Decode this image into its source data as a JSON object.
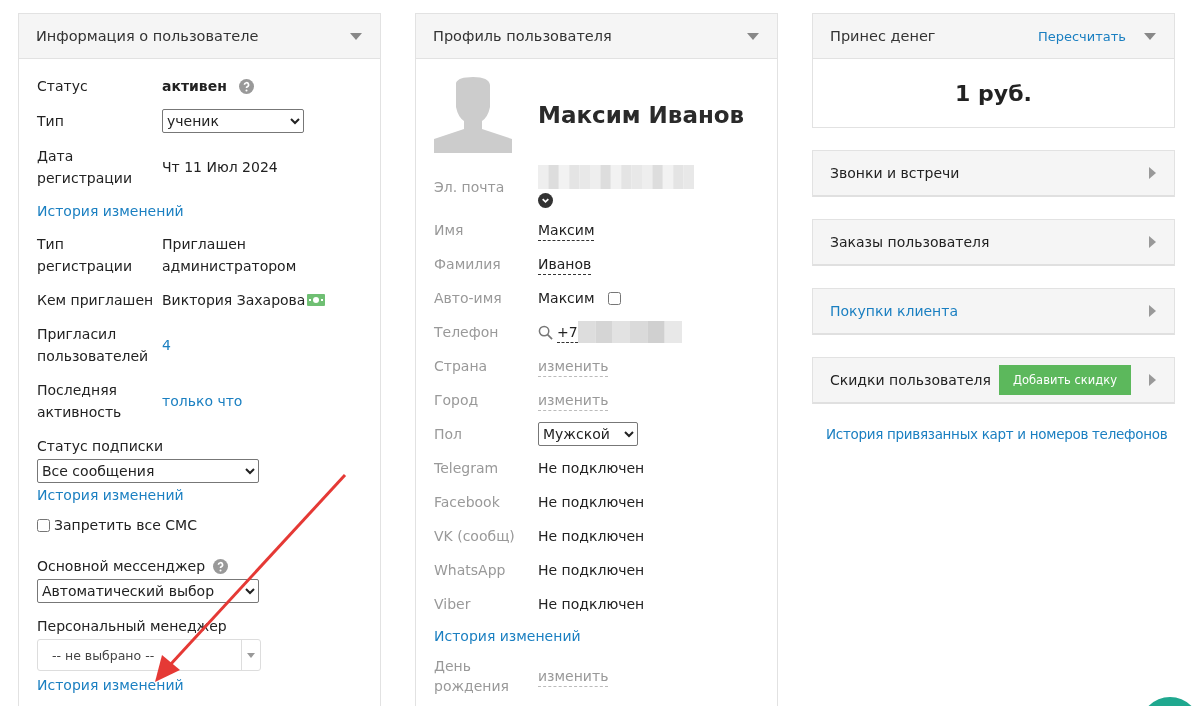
{
  "user_info": {
    "title": "Информация о пользователе",
    "rows": [
      {
        "kind": "bold_field",
        "label": "Статус",
        "value": "активен",
        "help": true
      },
      {
        "kind": "select",
        "label": "Тип",
        "value": "ученик"
      },
      {
        "kind": "field",
        "label": "Дата регистрации",
        "value": "Чт 11 Июл 2024"
      },
      {
        "kind": "link",
        "text": "История изменений"
      },
      {
        "kind": "field",
        "label": "Тип регистрации",
        "value": "Приглашен администратором"
      },
      {
        "kind": "field",
        "label": "Кем приглашен",
        "value": "Виктория Захарова",
        "money_icon": true
      },
      {
        "kind": "link_field",
        "label": "Пригласил пользователей",
        "value": "4"
      },
      {
        "kind": "link_field",
        "label": "Последняя активность",
        "value": "только что"
      },
      {
        "kind": "stacked_select",
        "label": "Статус подписки",
        "value": "Все сообщения"
      },
      {
        "kind": "link",
        "text": "История изменений"
      },
      {
        "kind": "checkbox",
        "label": "Запретить все СМС",
        "checked": false
      },
      {
        "kind": "stacked_select",
        "label": "Основной мессенджер",
        "value": "Автоматический выбор",
        "help": true
      },
      {
        "kind": "combo",
        "label": "Персональный менеджер",
        "value": "-- не выбрано --"
      },
      {
        "kind": "link",
        "text": "История изменений"
      }
    ]
  },
  "profile": {
    "title": "Профиль пользователя",
    "name": "Максим Иванов",
    "rows": [
      {
        "kind": "redacted",
        "label": "Эл. почта"
      },
      {
        "kind": "dashed",
        "label": "Имя",
        "value": "Максим",
        "muted": false
      },
      {
        "kind": "dashed",
        "label": "Фамилия",
        "value": "Иванов",
        "muted": false
      },
      {
        "kind": "checkbox",
        "label": "Авто-имя",
        "value": "Максим",
        "checked": false
      },
      {
        "kind": "phone",
        "label": "Телефон",
        "value": "+7"
      },
      {
        "kind": "dashed",
        "label": "Страна",
        "value": "изменить",
        "muted": true
      },
      {
        "kind": "dashed",
        "label": "Город",
        "value": "изменить",
        "muted": true
      },
      {
        "kind": "select",
        "label": "Пол",
        "value": "Мужской"
      },
      {
        "kind": "text",
        "label": "Telegram",
        "value": "Не подключен"
      },
      {
        "kind": "text",
        "label": "Facebook",
        "value": "Не подключен"
      },
      {
        "kind": "text",
        "label": "VK (сообщ)",
        "value": "Не подключен"
      },
      {
        "kind": "text",
        "label": "WhatsApp",
        "value": "Не подключен"
      },
      {
        "kind": "text",
        "label": "Viber",
        "value": "Не подключен"
      },
      {
        "kind": "link",
        "text": "История изменений"
      },
      {
        "kind": "dashed",
        "label": "День рождения",
        "value": "изменить",
        "muted": true
      }
    ]
  },
  "money": {
    "title": "Принес денег",
    "action": "Пересчитать",
    "amount": "1 руб."
  },
  "sections": [
    {
      "title": "Звонки и встречи",
      "link": false
    },
    {
      "title": "Заказы пользователя",
      "link": false
    },
    {
      "title": "Покупки клиента",
      "link": true
    },
    {
      "title": "Скидки пользователя",
      "link": false,
      "button": "Добавить скидку"
    }
  ],
  "cards_history_link": "История привязанных карт и номеров телефонов"
}
